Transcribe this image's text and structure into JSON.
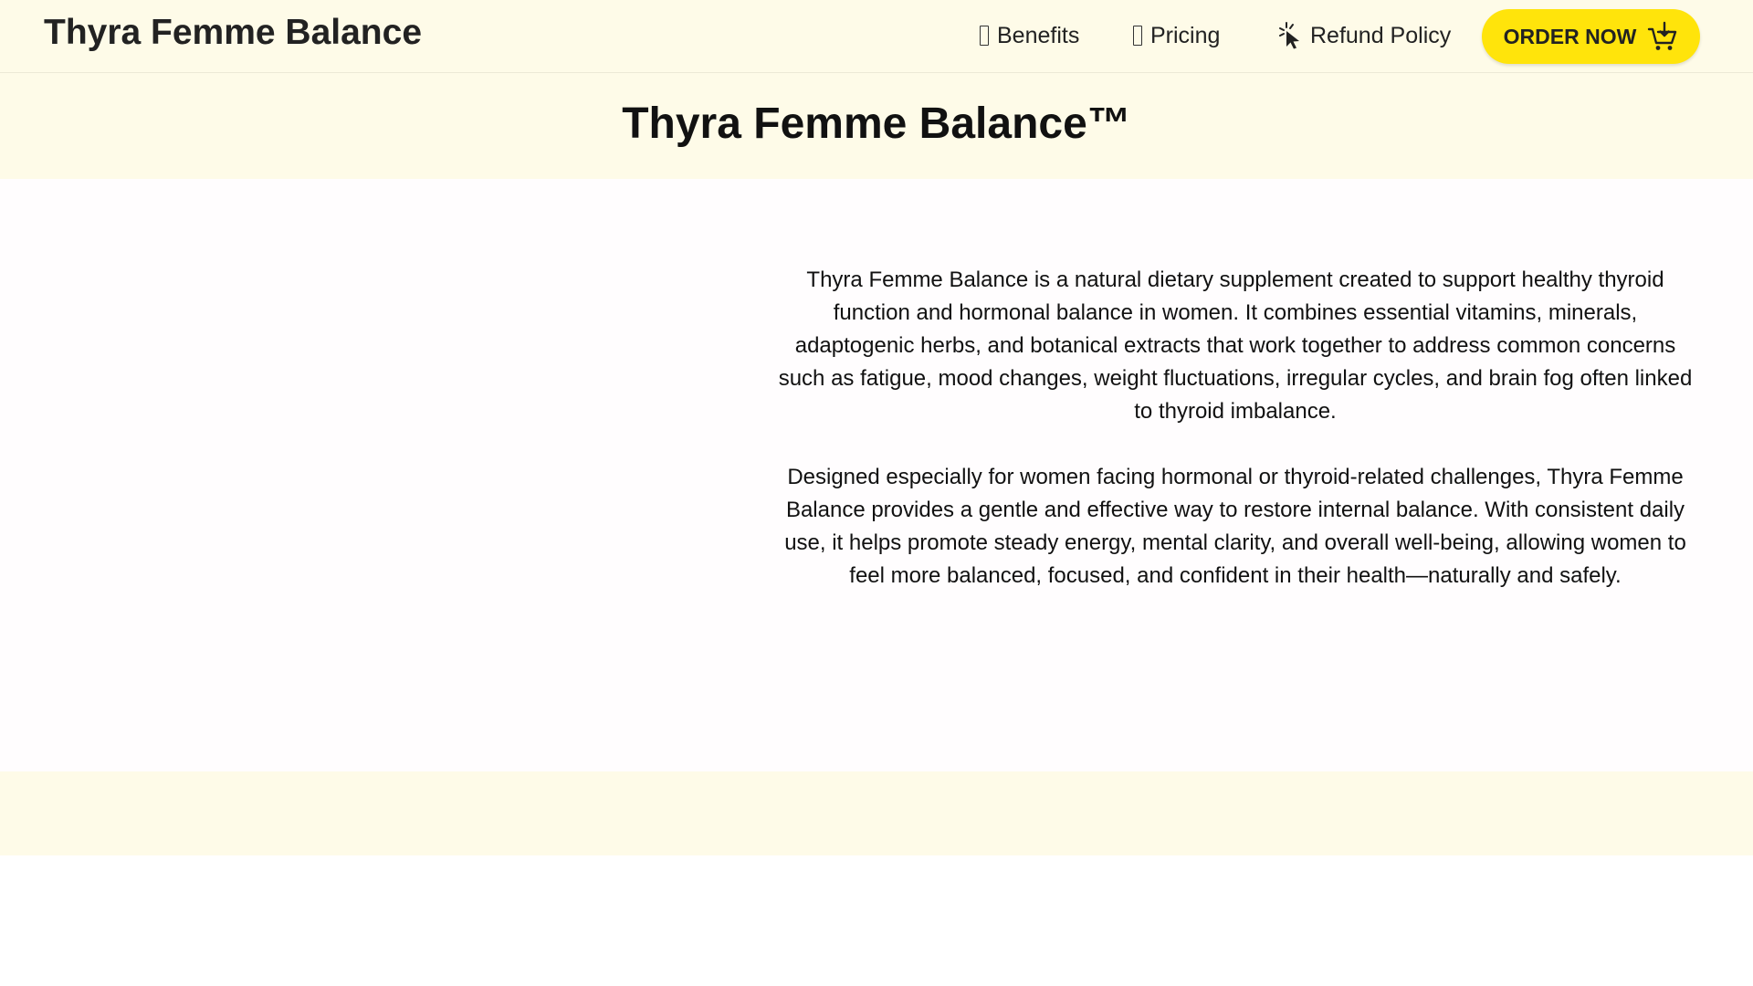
{
  "header": {
    "brand": "Thyra Femme Balance",
    "nav": [
      {
        "label": "Benefits",
        "icon": "missing-glyph-icon"
      },
      {
        "label": "Pricing",
        "icon": "missing-glyph-icon"
      },
      {
        "label": "Refund Policy",
        "icon": "cursor-click-icon"
      }
    ],
    "cta": {
      "label": "ORDER NOW",
      "icon": "cart-download-icon",
      "color": "#ffe40b"
    }
  },
  "hero": {
    "title": "Thyra Femme Balance™"
  },
  "main": {
    "paragraphs": [
      "Thyra Femme Balance is a natural dietary supplement created to support healthy thyroid function and hormonal balance in women. It combines essential vitamins, minerals, adaptogenic herbs, and botanical extracts that work together to address common concerns such as fatigue, mood changes, weight fluctuations, irregular cycles, and brain fog often linked to thyroid imbalance.",
      "Designed especially for women facing hormonal or thyroid-related challenges, Thyra Femme Balance provides a gentle and effective way to restore internal balance. With consistent daily use, it helps promote steady energy, mental clarity, and overall well-being, allowing women to feel more balanced, focused, and confident in their health—naturally and safely."
    ]
  },
  "theme": {
    "band_color": "#fefbe8",
    "accent": "#ffe40b",
    "text": "#111111"
  }
}
